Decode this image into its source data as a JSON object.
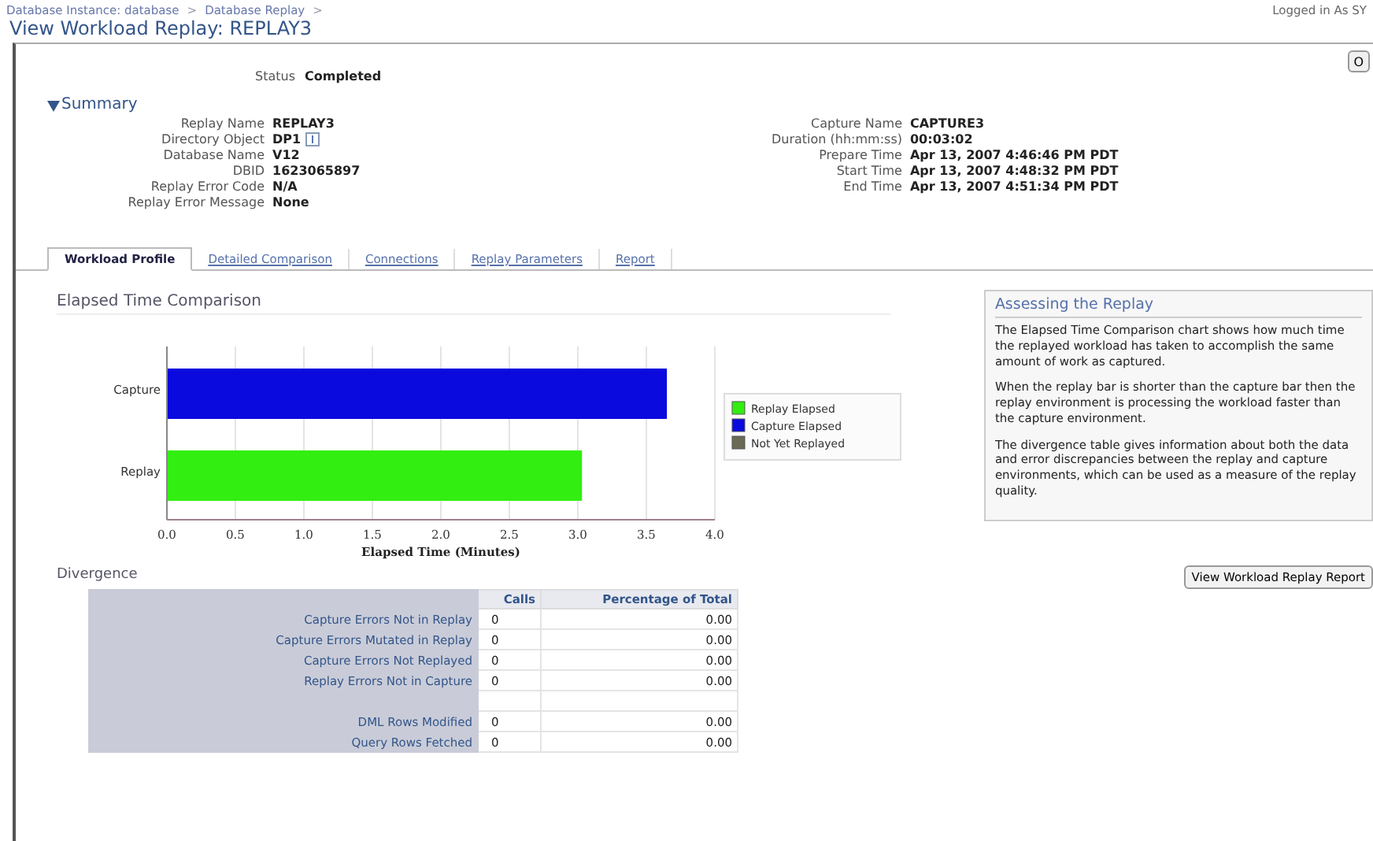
{
  "breadcrumb": [
    {
      "label": "Database Instance: database",
      "separator": ">"
    },
    {
      "label": "Database Replay",
      "separator": ">"
    }
  ],
  "user_status": "Logged in As SY",
  "title": "View Workload Replay: REPLAY3",
  "ok_button": "O",
  "status": {
    "label": "Status",
    "value": "Completed"
  },
  "summary": {
    "title": "Summary",
    "expanded": true,
    "left": [
      {
        "label": "Replay Name",
        "value": "REPLAY3"
      },
      {
        "label": "Directory Object",
        "value": "DP1",
        "kind": "info"
      },
      {
        "label": "Database Name",
        "value": "V12"
      },
      {
        "label": "DBID",
        "value": "1623065897"
      },
      {
        "label": "Replay Error Code",
        "value": "N/A"
      },
      {
        "label": "Replay Error Message",
        "value": "None"
      }
    ],
    "right": [
      {
        "label": "Capture Name",
        "value": "CAPTURE3"
      },
      {
        "label": "Duration (hh:mm:ss)",
        "value": "00:03:02"
      },
      {
        "label": "Prepare Time",
        "value": "Apr 13, 2007 4:46:46 PM PDT"
      },
      {
        "label": "Start Time",
        "value": "Apr 13, 2007 4:48:32 PM PDT"
      },
      {
        "label": "End Time",
        "value": "Apr 13, 2007 4:51:34 PM PDT"
      }
    ]
  },
  "tabs": [
    {
      "label": "Workload Profile",
      "selected": true
    },
    {
      "label": "Detailed Comparison",
      "selected": false
    },
    {
      "label": "Connections",
      "selected": false
    },
    {
      "label": "Replay Parameters",
      "selected": false
    },
    {
      "label": "Report",
      "selected": false
    }
  ],
  "elapsed": {
    "title": "Elapsed Time Comparison",
    "chart_data": {
      "type": "bar",
      "orientation": "horizontal",
      "stacked": true,
      "grid": true,
      "legend": true,
      "xlabel": "Elapsed Time (Minutes)",
      "categories": [
        "Capture",
        "Replay"
      ],
      "xlim": [
        0,
        4
      ],
      "xticks": [
        {
          "value": 0,
          "label": "0.0"
        },
        {
          "value": 0.5,
          "label": "0.5"
        },
        {
          "value": 1,
          "label": "1.0"
        },
        {
          "value": 1.5,
          "label": "1.5"
        },
        {
          "value": 2,
          "label": "2.0"
        },
        {
          "value": 2.5,
          "label": "2.5"
        },
        {
          "value": 3,
          "label": "3.0"
        },
        {
          "value": 3.5,
          "label": "3.5"
        },
        {
          "value": 4,
          "label": "4.0"
        }
      ],
      "series": [
        {
          "name": "Replay Elapsed",
          "color": "#33ee11",
          "values": [
            null,
            3.03
          ]
        },
        {
          "name": "Capture Elapsed",
          "color": "#0a0adf",
          "values": [
            3.65,
            null
          ]
        },
        {
          "name": "Not Yet Replayed",
          "color": "#6b6b55",
          "values": [
            null,
            null
          ]
        }
      ]
    }
  },
  "divergence": {
    "title": "Divergence",
    "columns": [
      "Calls",
      "Percentage of Total"
    ],
    "rows": [
      {
        "kind": "data",
        "label": "Capture Errors Not in Replay",
        "calls": "0",
        "percentage": "0.00"
      },
      {
        "kind": "data",
        "label": "Capture Errors Mutated in Replay",
        "calls": "0",
        "percentage": "0.00"
      },
      {
        "kind": "data",
        "label": "Capture Errors Not Replayed",
        "calls": "0",
        "percentage": "0.00"
      },
      {
        "kind": "data",
        "label": "Replay Errors Not in Capture",
        "calls": "0",
        "percentage": "0.00"
      },
      {
        "kind": "spacer"
      },
      {
        "kind": "data",
        "label": "DML Rows Modified",
        "calls": "0",
        "percentage": "0.00"
      },
      {
        "kind": "data",
        "label": "Query Rows Fetched",
        "calls": "0",
        "percentage": "0.00"
      }
    ]
  },
  "help": {
    "title": "Assessing the Replay",
    "paragraphs": [
      "The Elapsed Time Comparison chart shows how much time the replayed workload has taken to accomplish the same amount of work as captured.",
      "When the replay bar is shorter than the capture bar then the replay environment is processing the workload faster than the capture environment.",
      "The divergence table gives information about both the data and error discrepancies between the replay and capture environments, which can be used as a measure of the replay quality."
    ]
  },
  "report_button": "View Workload Replay Report"
}
